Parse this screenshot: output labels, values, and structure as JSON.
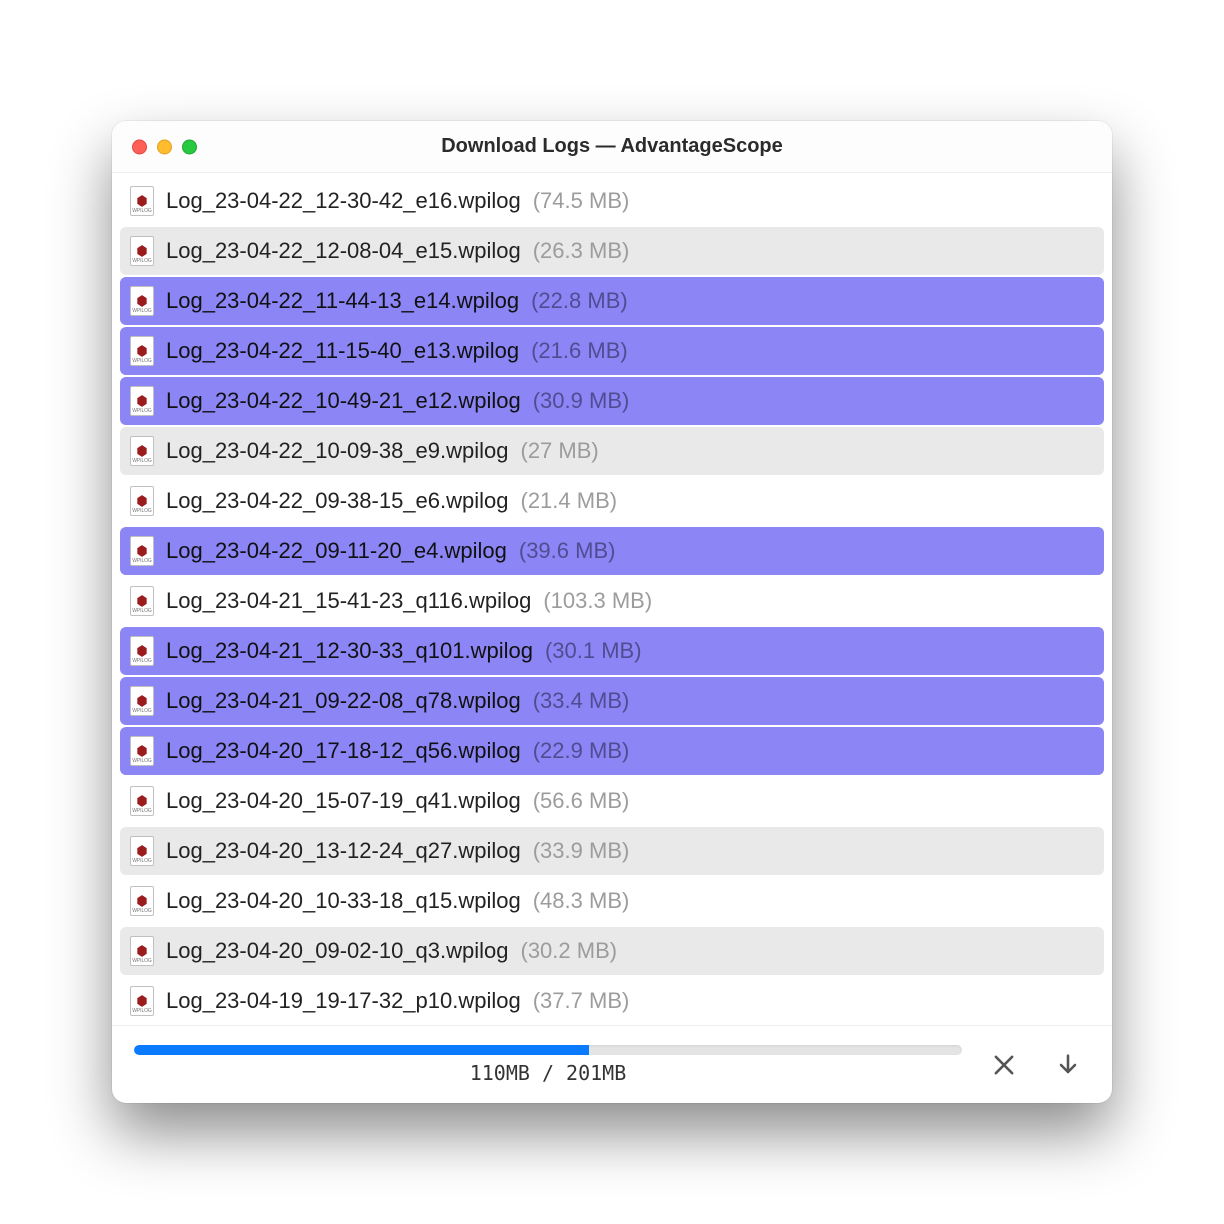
{
  "title": "Download Logs — AdvantageScope",
  "progress": {
    "label": "110MB / 201MB",
    "percent": 55
  },
  "logs": [
    {
      "name": "Log_23-04-22_12-30-42_e16.wpilog",
      "size": "(74.5 MB)",
      "selected": false
    },
    {
      "name": "Log_23-04-22_12-08-04_e15.wpilog",
      "size": "(26.3 MB)",
      "selected": false
    },
    {
      "name": "Log_23-04-22_11-44-13_e14.wpilog",
      "size": "(22.8 MB)",
      "selected": true
    },
    {
      "name": "Log_23-04-22_11-15-40_e13.wpilog",
      "size": "(21.6 MB)",
      "selected": true
    },
    {
      "name": "Log_23-04-22_10-49-21_e12.wpilog",
      "size": "(30.9 MB)",
      "selected": true
    },
    {
      "name": "Log_23-04-22_10-09-38_e9.wpilog",
      "size": "(27 MB)",
      "selected": false
    },
    {
      "name": "Log_23-04-22_09-38-15_e6.wpilog",
      "size": "(21.4 MB)",
      "selected": false
    },
    {
      "name": "Log_23-04-22_09-11-20_e4.wpilog",
      "size": "(39.6 MB)",
      "selected": true
    },
    {
      "name": "Log_23-04-21_15-41-23_q116.wpilog",
      "size": "(103.3 MB)",
      "selected": false
    },
    {
      "name": "Log_23-04-21_12-30-33_q101.wpilog",
      "size": "(30.1 MB)",
      "selected": true
    },
    {
      "name": "Log_23-04-21_09-22-08_q78.wpilog",
      "size": "(33.4 MB)",
      "selected": true
    },
    {
      "name": "Log_23-04-20_17-18-12_q56.wpilog",
      "size": "(22.9 MB)",
      "selected": true
    },
    {
      "name": "Log_23-04-20_15-07-19_q41.wpilog",
      "size": "(56.6 MB)",
      "selected": false
    },
    {
      "name": "Log_23-04-20_13-12-24_q27.wpilog",
      "size": "(33.9 MB)",
      "selected": false
    },
    {
      "name": "Log_23-04-20_10-33-18_q15.wpilog",
      "size": "(48.3 MB)",
      "selected": false
    },
    {
      "name": "Log_23-04-20_09-02-10_q3.wpilog",
      "size": "(30.2 MB)",
      "selected": false
    },
    {
      "name": "Log_23-04-19_19-17-32_p10.wpilog",
      "size": "(37.7 MB)",
      "selected": false
    }
  ]
}
